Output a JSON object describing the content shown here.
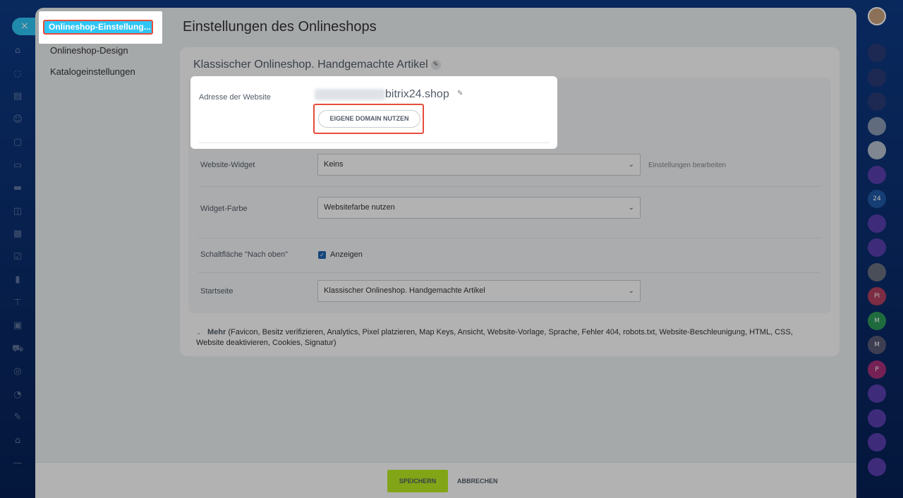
{
  "window": {
    "close_icon": "×"
  },
  "left_rail": {
    "icons": [
      "☰",
      "⌂",
      "◌",
      "▤",
      "☺",
      "▢",
      "▭",
      "▬",
      "◫",
      "▦",
      "☑",
      "▮",
      "⊤",
      "▣",
      "⛟",
      "◎",
      "◔",
      "✎",
      "⌂",
      "—"
    ]
  },
  "right_rail": {
    "top_avatar_color": "#c9a27e",
    "items": [
      {
        "label": "",
        "color": "#2a3c78"
      },
      {
        "label": "",
        "color": "#2a3c78"
      },
      {
        "label": "",
        "color": "#2a3c78"
      },
      {
        "label": "",
        "color": "#8a9bb5"
      },
      {
        "label": "",
        "color": "#b8c2d0"
      },
      {
        "label": "",
        "color": "#5a3fb0"
      },
      {
        "label": "24",
        "color": "#1f5aa8"
      },
      {
        "label": "",
        "color": "#5a3fb0"
      },
      {
        "label": "",
        "color": "#5a3fb0"
      },
      {
        "label": "",
        "color": "#6a7080"
      },
      {
        "label": "PI",
        "color": "#b24060"
      },
      {
        "label": "M",
        "color": "#2f9a5a"
      },
      {
        "label": "M",
        "color": "#5a5a78"
      },
      {
        "label": "P",
        "color": "#a8307a"
      },
      {
        "label": "",
        "color": "#5a3fb0"
      },
      {
        "label": "",
        "color": "#5a3fb0"
      },
      {
        "label": "",
        "color": "#5a3fb0"
      },
      {
        "label": "",
        "color": "#5a3fb0"
      }
    ]
  },
  "side_menu": {
    "active": "Onlineshop-Einstellung...",
    "items": [
      "Onlineshop-Design",
      "Katalogeinstellungen"
    ]
  },
  "page_title": "Einstellungen des Onlineshops",
  "site": {
    "name": "Klassischer Onlineshop. Handgemachte Artikel"
  },
  "address": {
    "label": "Adresse der Website",
    "domain": "bitrix24.shop",
    "button": "EIGENE DOMAIN NUTZEN"
  },
  "fields": {
    "widget": {
      "label": "Website-Widget",
      "value": "Keins",
      "link": "Einstellungen bearbeiten"
    },
    "widget_color": {
      "label": "Widget-Farbe",
      "value": "Websitefarbe nutzen"
    },
    "scroll_top": {
      "label": "Schaltfläche \"Nach oben\"",
      "checkbox_label": "Anzeigen",
      "checked": true
    },
    "start_page": {
      "label": "Startseite",
      "value": "Klassischer Onlineshop. Handgemachte Artikel"
    }
  },
  "more": {
    "label": "Mehr",
    "items": "(Favicon, Besitz verifizieren, Analytics, Pixel platzieren, Map Keys, Ansicht, Website-Vorlage, Sprache, Fehler 404, robots.txt, Website-Beschleunigung, HTML, CSS, Website deaktivieren, Cookies, Signatur)"
  },
  "footer": {
    "save": "SPEICHERN",
    "cancel": "ABBRECHEN"
  },
  "colors": {
    "accent": "#2fc6f6",
    "save": "#bbed21",
    "highlight": "#e74c3c"
  }
}
